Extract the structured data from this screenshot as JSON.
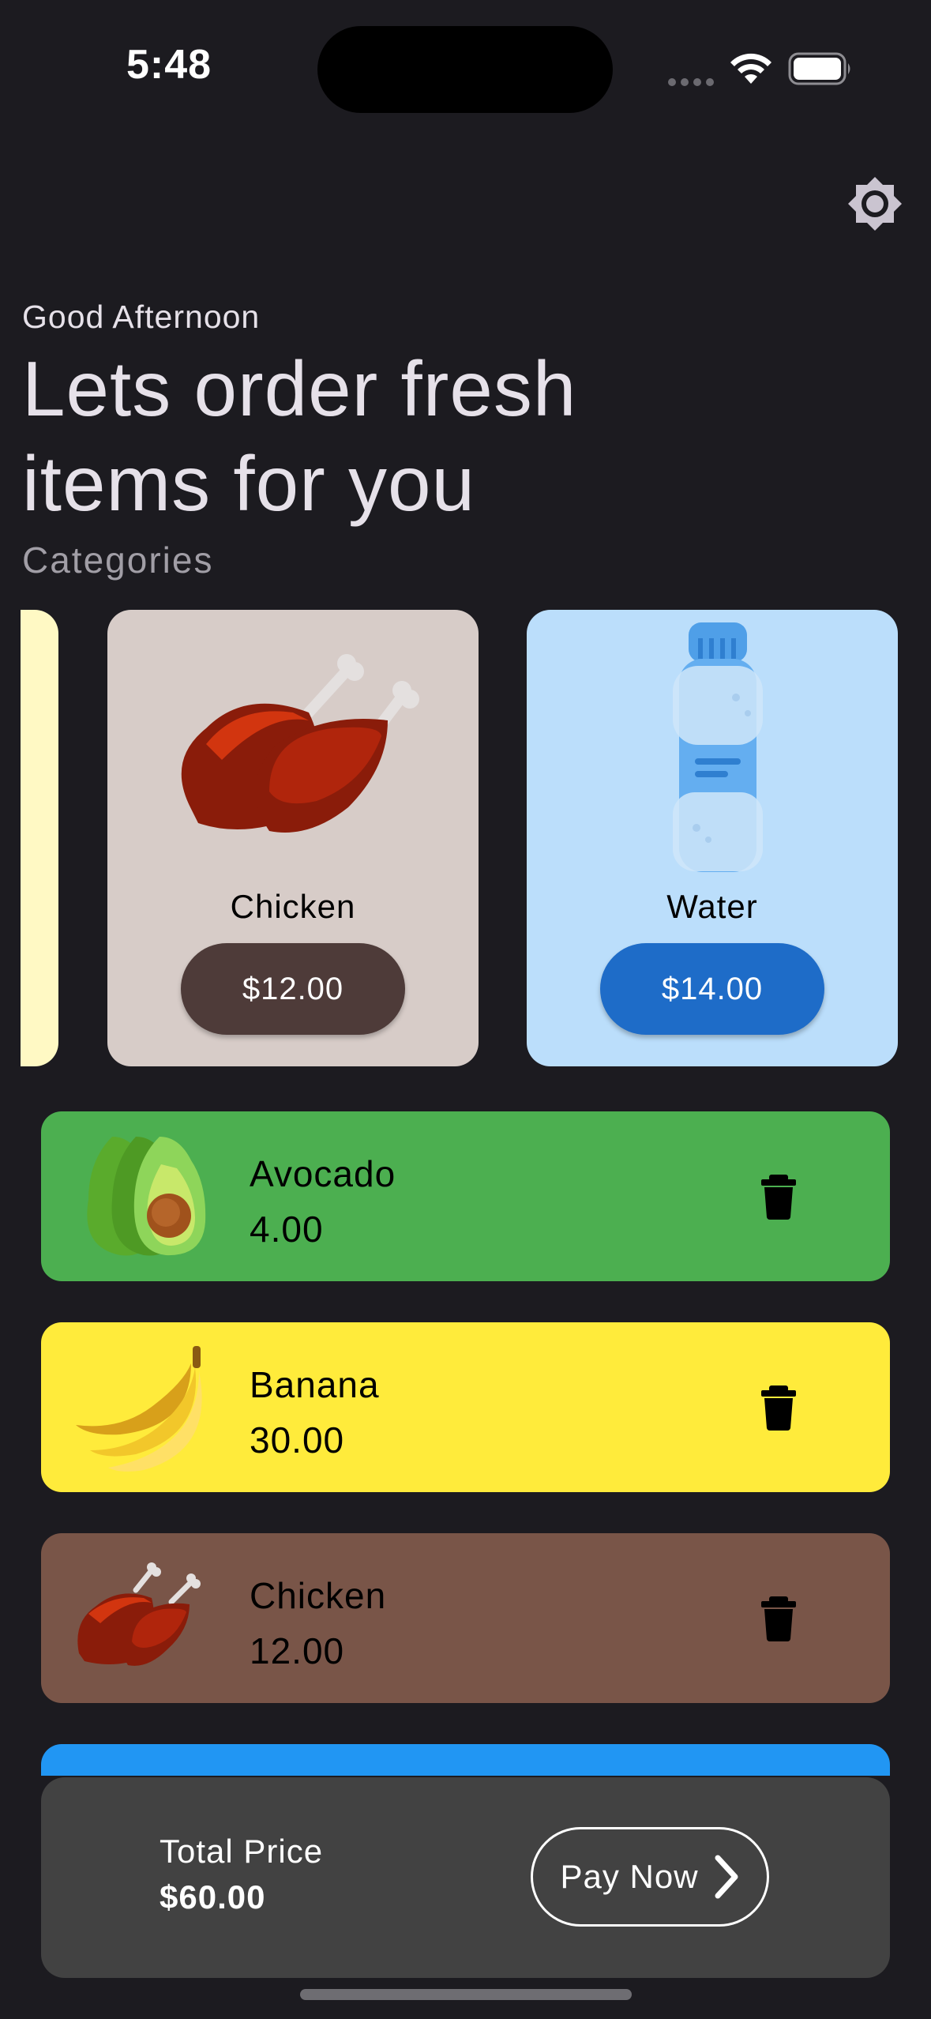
{
  "status_bar": {
    "time": "5:48"
  },
  "header": {
    "greeting": "Good Afternoon",
    "headline": "Lets order fresh items for you",
    "categories_label": "Categories"
  },
  "categories": [
    {
      "name": "Chicken",
      "price": "$12.00",
      "bg": "#d7ccc8",
      "button_color": "#4e3b39",
      "icon": "chicken-icon"
    },
    {
      "name": "Water",
      "price": "$14.00",
      "bg": "#bbdefb",
      "button_color": "#1e6cc8",
      "icon": "water-bottle-icon"
    }
  ],
  "cart": [
    {
      "name": "Avocado",
      "price": "4.00",
      "bg": "#4caf50",
      "icon": "avocado-icon"
    },
    {
      "name": "Banana",
      "price": "30.00",
      "bg": "#ffeb3b",
      "icon": "banana-icon"
    },
    {
      "name": "Chicken",
      "price": "12.00",
      "bg": "#795548",
      "icon": "chicken-icon"
    }
  ],
  "checkout": {
    "total_label": "Total Price",
    "total_value": "$60.00",
    "pay_label": "Pay Now"
  },
  "colors": {
    "background": "#1c1b20",
    "bottom_bar": "#424242",
    "peek_card": "#fff9c4",
    "peek_row": "#2196f3"
  }
}
